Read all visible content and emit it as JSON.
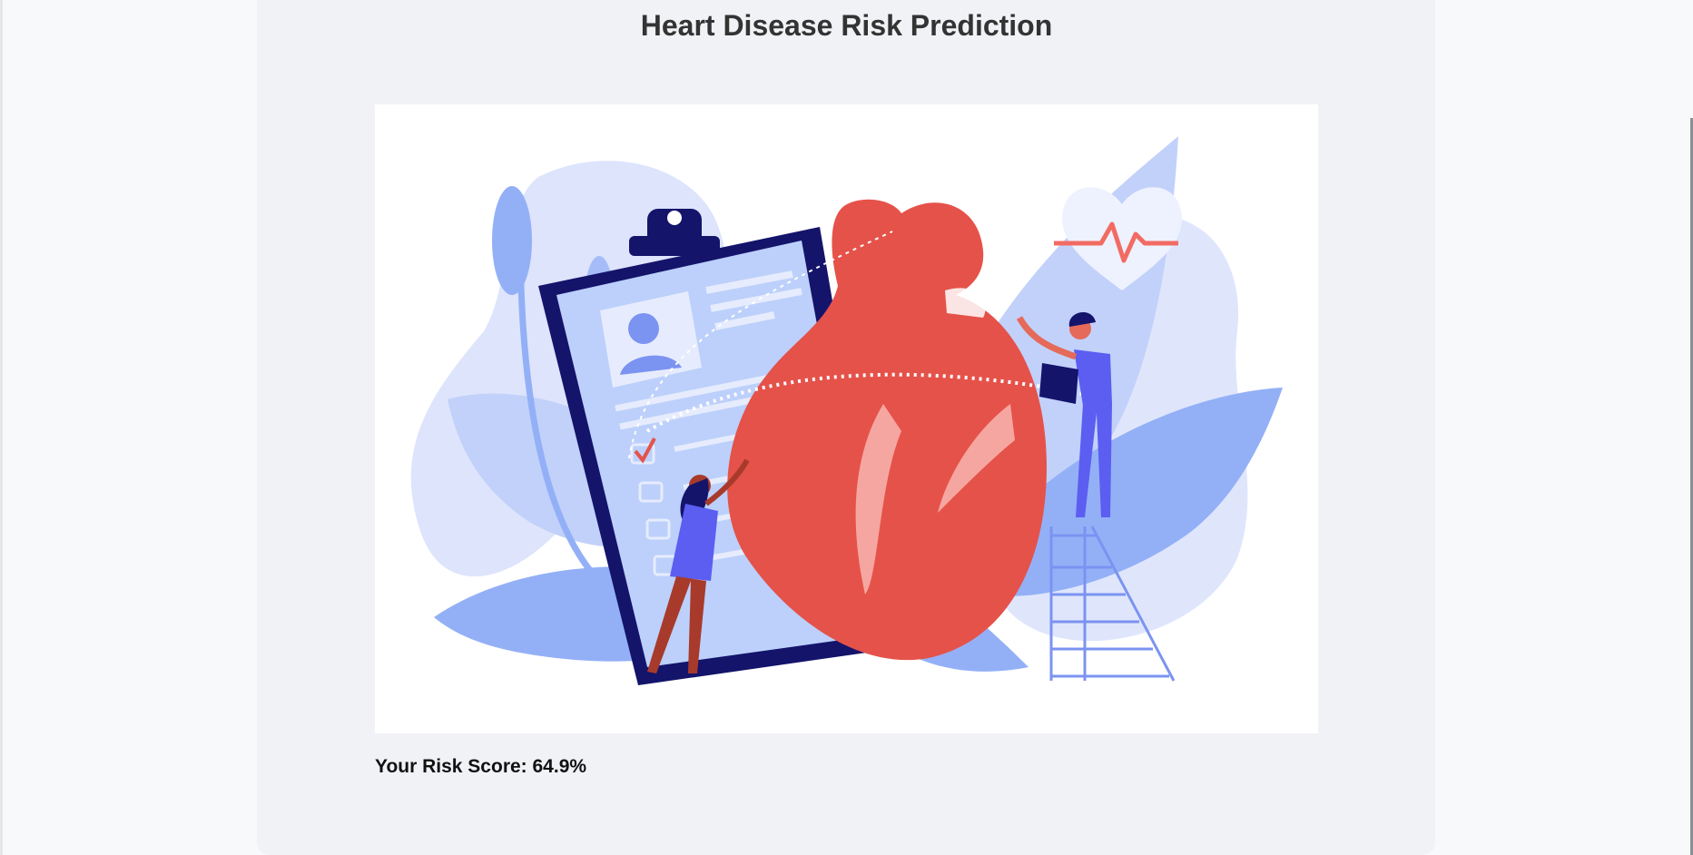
{
  "page": {
    "title": "Heart Disease Risk Prediction"
  },
  "illustration": {
    "icon": "heart-health-illustration",
    "colors": {
      "heart": "#e5524a",
      "heart_highlight": "#f6a6a0",
      "blue_primary": "#5b5ef0",
      "blue_light": "#c9d5fb",
      "blue_mid": "#8fa9f5",
      "navy": "#14146b",
      "skin": "#a83a2c"
    }
  },
  "result": {
    "label": "Your Risk Score:",
    "value": "64.9%",
    "text": "Your Risk Score: 64.9%"
  }
}
